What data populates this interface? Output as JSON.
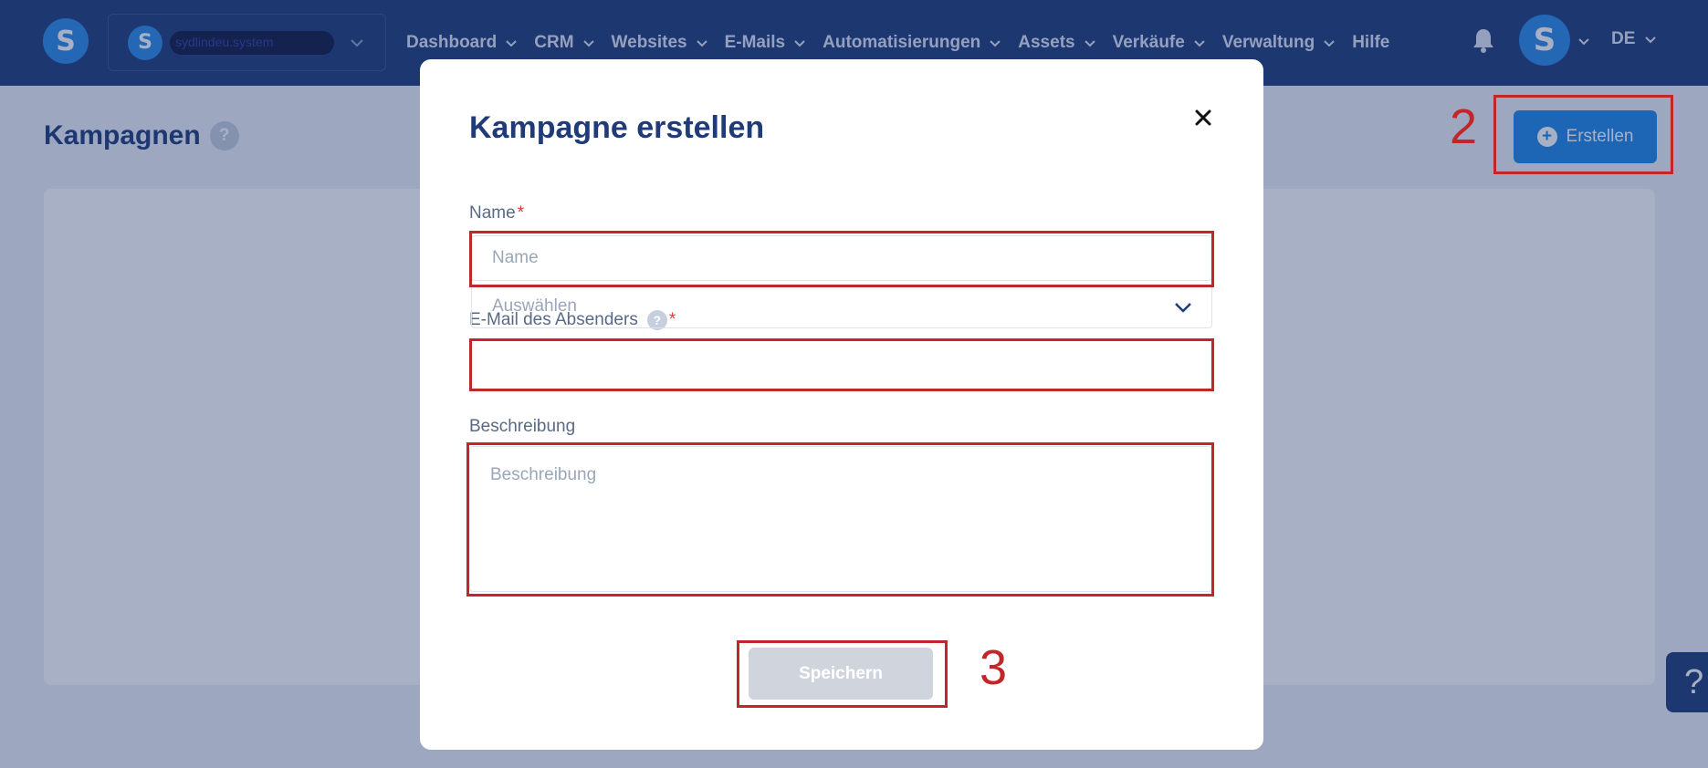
{
  "brand": {
    "logo_letter": "S"
  },
  "account": {
    "logo_letter": "S",
    "name": "sydlindeu.system"
  },
  "nav": {
    "items": [
      {
        "label": "Dashboard",
        "has_dropdown": true
      },
      {
        "label": "CRM",
        "has_dropdown": true
      },
      {
        "label": "Websites",
        "has_dropdown": true
      },
      {
        "label": "E-Mails",
        "has_dropdown": true
      },
      {
        "label": "Automatisierungen",
        "has_dropdown": true
      },
      {
        "label": "Assets",
        "has_dropdown": true
      },
      {
        "label": "Verkäufe",
        "has_dropdown": true
      },
      {
        "label": "Verwaltung",
        "has_dropdown": true
      },
      {
        "label": "Hilfe",
        "has_dropdown": false
      }
    ],
    "notification_icon": "bell-icon",
    "user_avatar_letter": "S",
    "language": "DE"
  },
  "page": {
    "title": "Kampagnen",
    "help_badge": "?",
    "create_button": {
      "label": "Erstellen",
      "icon": "plus-circle-icon"
    },
    "support_tab": "?"
  },
  "modal": {
    "title": "Kampagne erstellen",
    "close_icon": "close-icon",
    "fields": {
      "name": {
        "label": "Name",
        "required_marker": "*",
        "placeholder": "Name",
        "value": ""
      },
      "sender_email": {
        "label": "E-Mail des Absenders",
        "help": "?",
        "required_marker": "*",
        "placeholder": "Auswählen"
      },
      "description": {
        "label": "Beschreibung",
        "placeholder": "Beschreibung",
        "value": ""
      }
    },
    "save_button": {
      "label": "Speichern",
      "enabled": false
    }
  },
  "annotations": {
    "create_step": "2",
    "save_step": "3"
  },
  "colors": {
    "topbar": "#1f3c78",
    "accent": "#1e88e5",
    "annotation": "#c0262a",
    "required": "#e53935",
    "save_disabled": "#d0d5dd"
  }
}
